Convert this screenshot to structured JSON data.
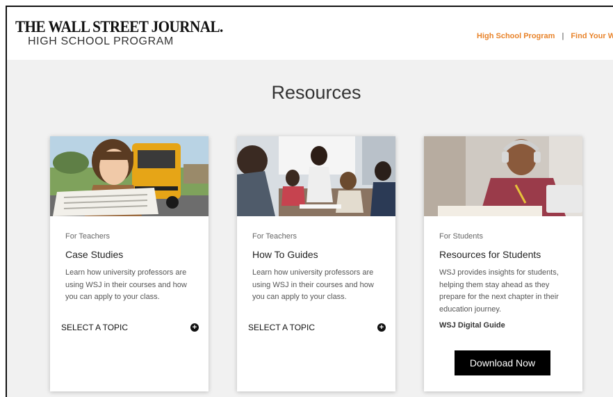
{
  "header": {
    "logo_title": "THE WALL STREET JOURNAL.",
    "logo_subtitle": "HIGH SCHOOL PROGRAM",
    "nav": [
      {
        "label": "High School Program"
      },
      {
        "label": "Find Your WS"
      }
    ],
    "nav_separator": "|"
  },
  "page": {
    "title": "Resources"
  },
  "cards": [
    {
      "image_icon": "teacher-with-newspaper-photo",
      "tag": "For Teachers",
      "title": "Case Studies",
      "description": "Learn how university professors are using WSJ in their courses and how you can apply to your class.",
      "select_label": "SELECT A TOPIC",
      "select_icon": "plus-circle-icon"
    },
    {
      "image_icon": "classroom-students-photo",
      "tag": "For Teachers",
      "title": "How To Guides",
      "description": "Learn how university professors are using WSJ in their courses and how you can apply to your class.",
      "select_label": "SELECT A TOPIC",
      "select_icon": "plus-circle-icon"
    },
    {
      "image_icon": "student-with-headphones-photo",
      "tag": "For Students",
      "title": "Resources for Students",
      "description": "WSJ provides insights for students, helping them stay ahead as they prepare for the next chapter in their education journey.",
      "guide_label": "WSJ Digital Guide",
      "button_label": "Download Now"
    }
  ],
  "colors": {
    "accent": "#e8832a",
    "button_bg": "#000000",
    "page_bg": "#f1f1f1"
  }
}
